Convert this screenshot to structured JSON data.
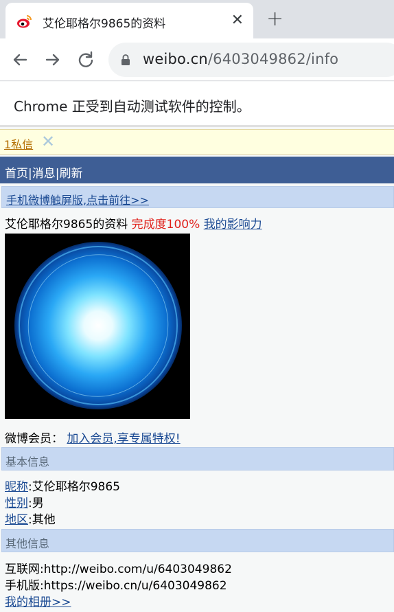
{
  "browser": {
    "tab_title": "艾伦耶格尔9865的资料",
    "tab_close": "✕",
    "new_tab": "+",
    "url_host": "weibo.cn",
    "url_path": "/6403049862/info",
    "infobar_text": "Chrome 正受到自动测试软件的控制。"
  },
  "page": {
    "message_link": "1私信",
    "message_close": "✕",
    "nav": "首页|消息|刷新",
    "touch_link": "手机微博触屏版,点击前往>>",
    "profile": {
      "title": "艾伦耶格尔9865的资料",
      "completion": "完成度100%",
      "influence_link": "我的影响力",
      "vip_label": "微博会员：",
      "vip_link": "加入会员,享专属特权!"
    },
    "basic_section": "基本信息",
    "basic": {
      "nickname_label": "昵称",
      "nickname_value": ":艾伦耶格尔9865",
      "gender_label": "性别",
      "gender_value": ":男",
      "region_label": "地区",
      "region_value": ":其他"
    },
    "other_section": "其他信息",
    "other": {
      "internet": "互联网:http://weibo.com/u/6403049862",
      "mobile": "手机版:https://weibo.cn/u/6403049862",
      "album_link": "我的相册>>"
    }
  }
}
